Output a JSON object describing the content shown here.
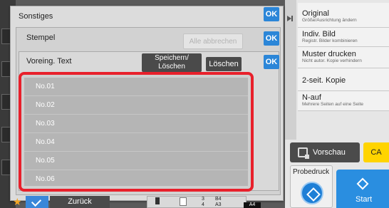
{
  "dialog": {
    "title": "Sonstiges",
    "ok_label": "OK",
    "stempel": {
      "title": "Stempel",
      "cancel_all_label": "Alle abbrechen",
      "ok_label": "OK"
    },
    "preset_text": {
      "title": "Voreing. Text",
      "save_delete_label": "Speichern/ Löschen",
      "delete_label": "Löschen",
      "ok_label": "OK",
      "items": [
        "No.01",
        "No.02",
        "No.03",
        "No.04",
        "No.05",
        "No.06"
      ]
    },
    "highlight_color": "#e8202b"
  },
  "right_panel": {
    "items": [
      {
        "title": "Original",
        "subtitle": "Größe/Ausrichtung ändern"
      },
      {
        "title": "Indiv. Bild",
        "subtitle": "Registr. Bilder kombinieren"
      },
      {
        "title": "Muster drucken",
        "subtitle": "Nicht autor. Kopie verhindern"
      },
      {
        "title": "2-seit. Kopie",
        "subtitle": ""
      },
      {
        "title": "N-auf",
        "subtitle": "Mehrere Seiten auf eine Seite"
      }
    ],
    "preview_label": "Vorschau",
    "ca_label": "CA",
    "proof_label": "Probedruck",
    "start_label": "Start"
  },
  "bottom_bar": {
    "back_label": "Zurück",
    "tray_numbers": [
      "3",
      "4"
    ],
    "tray_sizes": [
      "B4",
      "A3"
    ],
    "tray_tag": "A4"
  },
  "colors": {
    "accent_blue": "#2b86d8",
    "ca_yellow": "#ffd400",
    "start_blue": "#2a8ee0"
  }
}
